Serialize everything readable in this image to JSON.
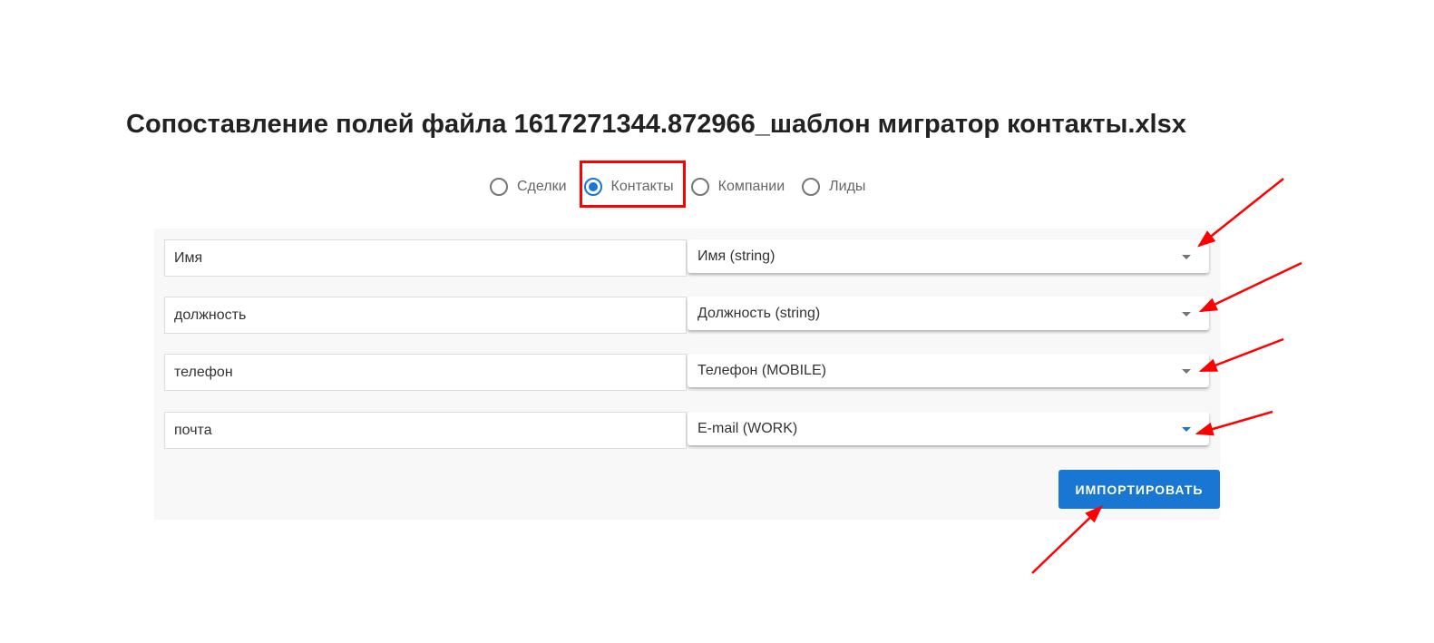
{
  "title": "Сопоставление полей файла 1617271344.872966_шаблон мигратор контакты.xlsx",
  "entity_types": [
    {
      "label": "Сделки",
      "selected": false
    },
    {
      "label": "Контакты",
      "selected": true
    },
    {
      "label": "Компании",
      "selected": false
    },
    {
      "label": "Лиды",
      "selected": false
    }
  ],
  "mappings": [
    {
      "source": "Имя",
      "target": "Имя (string)"
    },
    {
      "source": "должность",
      "target": "Должность (string)"
    },
    {
      "source": "телефон",
      "target": "Телефон (MOBILE)"
    },
    {
      "source": "почта",
      "target": "E-mail (WORK)"
    }
  ],
  "import_label": "ИМПОРТИРОВАТЬ",
  "colors": {
    "accent": "#1976d2",
    "annotation": "#ff0000"
  }
}
